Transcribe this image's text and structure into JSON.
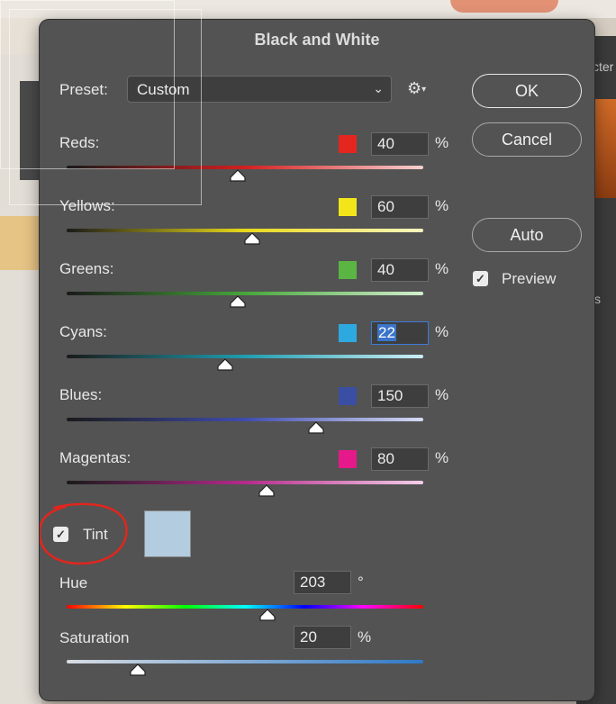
{
  "dialog": {
    "title": "Black and White",
    "preset_label": "Preset:",
    "preset_value": "Custom",
    "buttons": {
      "ok": "OK",
      "cancel": "Cancel",
      "auto": "Auto"
    },
    "preview_label": "Preview",
    "preview_checked": true
  },
  "sliders": [
    {
      "label": "Reds:",
      "value": "40",
      "unit": "%",
      "color": "#e5261f",
      "position_fraction": 0.48
    },
    {
      "label": "Yellows:",
      "value": "60",
      "unit": "%",
      "color": "#f2e51a",
      "position_fraction": 0.52
    },
    {
      "label": "Greens:",
      "value": "40",
      "unit": "%",
      "color": "#5ab543",
      "position_fraction": 0.48
    },
    {
      "label": "Cyans:",
      "value": "22",
      "unit": "%",
      "color": "#2ea9e0",
      "position_fraction": 0.445
    },
    {
      "label": "Blues:",
      "value": "150",
      "unit": "%",
      "color": "#3a4fa3",
      "position_fraction": 0.7
    },
    {
      "label": "Magentas:",
      "value": "80",
      "unit": "%",
      "color": "#e6198a",
      "position_fraction": 0.56
    }
  ],
  "tint": {
    "label": "Tint",
    "checked": true,
    "swatch_color": "#b3ccdf",
    "hue_label": "Hue",
    "hue_value": "203",
    "hue_unit": "°",
    "hue_fraction": 0.564,
    "saturation_label": "Saturation",
    "saturation_value": "20",
    "saturation_unit": "%",
    "saturation_fraction": 0.2
  },
  "background": {
    "panel_text_1": "cter",
    "panel_text_2": "s"
  }
}
